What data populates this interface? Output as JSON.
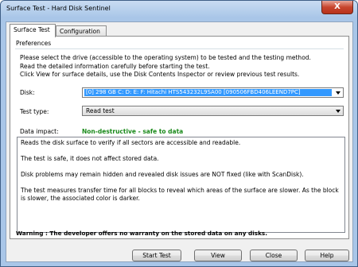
{
  "window": {
    "title": "Surface Test - Hard Disk Sentinel",
    "close_label": "X"
  },
  "tabs": [
    {
      "label": "Surface Test"
    },
    {
      "label": "Configuration"
    }
  ],
  "preferences": {
    "group_label": "Preferences",
    "intro": [
      "Please select the drive (accessible to the operating system) to be tested and the testing method.",
      "Read the detailed information carefully before starting the test.",
      "Click View for surface details, use the Disk Contents Inspector or review previous test results."
    ]
  },
  "disk": {
    "label": "Disk:",
    "value": "[0]   298 GB   C: D: E: F:   Hitachi HTS543232L9SA00 [090506FBD406LEEND7PC]"
  },
  "test_type": {
    "label": "Test type:",
    "value": "Read test"
  },
  "data_impact": {
    "label": "Data impact:",
    "value": "Non-destructive - safe to data"
  },
  "description": [
    "Reads the disk surface to verify if all sectors are accessible and readable.",
    "The test is safe, it does not affect stored data.",
    "Disk problems may remain hidden and revealed disk issues are NOT fixed (like with ScanDisk).",
    "The test measures transfer time for all blocks to reveal which areas of the surface are slower. As the block is slower, the associated color is darker."
  ],
  "warning": "Warning : The developer offers no warranty on the stored data on any disks.",
  "buttons": {
    "start_test": "Start Test",
    "view": "View",
    "close": "Close",
    "help": "Help"
  },
  "colors": {
    "selection": "#3399ff",
    "impact_safe": "#1a8a1a",
    "title_bg": "#a9c6e8",
    "close_button": "#c7452e"
  }
}
